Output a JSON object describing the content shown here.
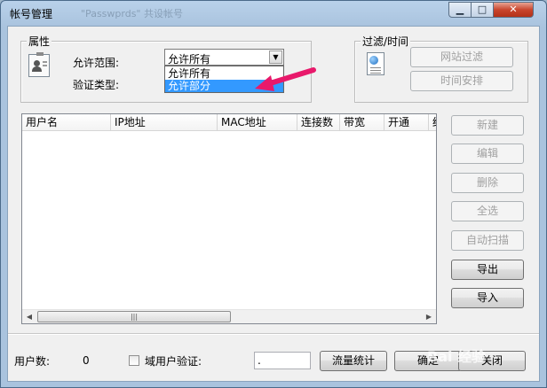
{
  "window": {
    "title": "帐号管理",
    "title_ghost": "\"Passwprds\" 共设帐号",
    "min_glyph": "▁",
    "max_glyph": "□",
    "close_glyph": "✕"
  },
  "properties": {
    "group_label": "属性",
    "scope_label": "允许范围:",
    "auth_label": "验证类型:",
    "combo_value": "允许所有",
    "combo_arrow": "▼",
    "dropdown_options": [
      {
        "label": "允许所有",
        "selected": false
      },
      {
        "label": "允许部分",
        "selected": true
      }
    ]
  },
  "filter": {
    "group_label": "过滤/时间",
    "site_filter_button": "网站过滤",
    "schedule_button": "时间安排"
  },
  "table": {
    "columns": [
      "用户名",
      "IP地址",
      "MAC地址",
      "连接数",
      "带宽",
      "开通",
      "结"
    ],
    "rows": [],
    "scroll_left": "◀",
    "scroll_right": "▶",
    "thumb_grip": "|||"
  },
  "side_buttons": {
    "new": "新建",
    "edit": "编辑",
    "delete": "删除",
    "select_all": "全选",
    "auto_scan": "自动扫描",
    "export": "导出",
    "import": "导入"
  },
  "footer": {
    "user_count_label": "用户数:",
    "user_count": "0",
    "domain_auth_label": "域用户验证:",
    "edit_value": ".",
    "traffic_button": "流量统计",
    "ok_button": "确定",
    "close_button": "关闭"
  },
  "colors": {
    "selection": "#3399ff",
    "annotation_arrow": "#e8196b"
  },
  "icons": {
    "properties": "user-badge-icon",
    "filter": "document-globe-icon"
  },
  "watermark": "Bai 经验"
}
